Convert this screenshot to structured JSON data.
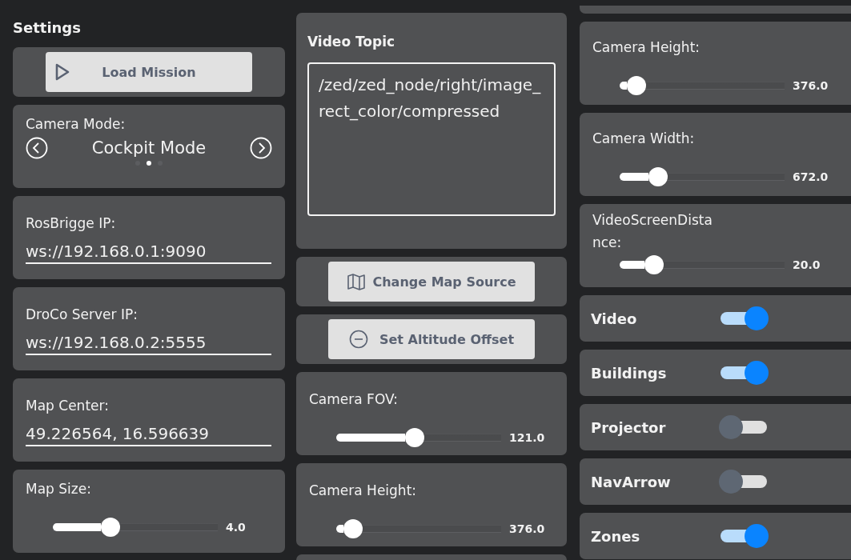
{
  "title": "Settings",
  "columns": [
    {
      "cards": [
        {
          "kind": "button",
          "label": "Load Mission"
        },
        {
          "kind": "carousel",
          "label": "Camera Mode:",
          "value": "Cockpit Mode",
          "pages": [
            {
              "selected": false
            },
            {
              "selected": true
            },
            {
              "selected": false
            }
          ]
        },
        {
          "kind": "field",
          "label": "RosBrigge IP:",
          "value": "ws://192.168.0.1:9090"
        },
        {
          "kind": "field",
          "label": "DroCo Server IP:",
          "value": "ws://192.168.0.2:5555"
        },
        {
          "kind": "field",
          "label": "Map Center:",
          "value": "49.226564, 16.596639"
        },
        {
          "kind": "slider",
          "label": "Map Size:",
          "level": 0.33,
          "reading": "4.0"
        }
      ]
    },
    {
      "cards": [
        {
          "kind": "textarea",
          "label": "Video Topic",
          "value": "/zed/zed_node/right/image_rect_color/compressed"
        },
        {
          "kind": "button",
          "label": "Change Map Source"
        },
        {
          "kind": "button",
          "label": "Set Altitude Offset"
        },
        {
          "kind": "slider",
          "label": "Camera FOV:",
          "level": 0.47,
          "reading": "121.0"
        },
        {
          "kind": "slider",
          "label": "Camera Height:",
          "level": 0.05,
          "reading": "376.0"
        },
        {
          "kind": "blank"
        }
      ]
    },
    {
      "cards": [
        {
          "kind": "blank"
        },
        {
          "kind": "slider",
          "label": "Camera Height:",
          "level": 0.05,
          "reading": "376.0"
        },
        {
          "kind": "slider",
          "label": "Camera Width:",
          "level": 0.2,
          "reading": "672.0"
        },
        {
          "kind": "slider",
          "label": "VideoScreenDistance:",
          "level": 0.17,
          "reading": "20.0"
        },
        {
          "kind": "toggle",
          "label": "Video",
          "on": true
        },
        {
          "kind": "toggle",
          "label": "Buildings",
          "on": true
        },
        {
          "kind": "toggle",
          "label": "Projector",
          "on": false
        },
        {
          "kind": "toggle",
          "label": "NavArrow",
          "on": false
        },
        {
          "kind": "toggle",
          "label": "Zones",
          "on": true
        }
      ]
    }
  ]
}
